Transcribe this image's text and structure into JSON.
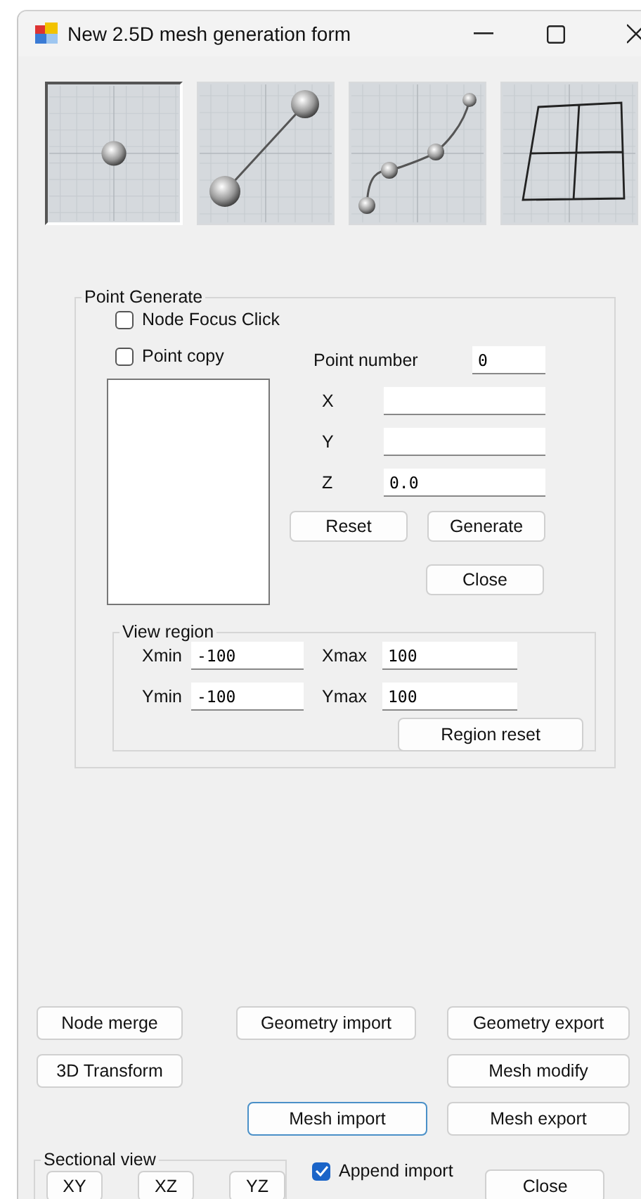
{
  "window": {
    "title": "New 2.5D mesh generation form"
  },
  "modes": [
    {
      "kind": "point",
      "selected": true
    },
    {
      "kind": "line",
      "selected": false
    },
    {
      "kind": "curve",
      "selected": false
    },
    {
      "kind": "quad",
      "selected": false
    }
  ],
  "point_generate": {
    "title": "Point Generate",
    "node_focus_click": {
      "label": "Node Focus Click",
      "checked": false
    },
    "point_copy": {
      "label": "Point copy",
      "checked": false
    },
    "point_number": {
      "label": "Point number",
      "value": "0"
    },
    "coords": [
      {
        "label": "X"
      },
      {
        "label": "Y"
      },
      {
        "label": "Z",
        "value": "0.0"
      }
    ],
    "reset_button": "Reset",
    "generate_button": "Generate",
    "close_button": "Close",
    "view_region": {
      "title": "View region",
      "fields": [
        {
          "label": "Xmin",
          "value": "-100"
        },
        {
          "label": "Xmax",
          "value": "100"
        },
        {
          "label": "Ymin",
          "value": "-100"
        },
        {
          "label": "Ymax",
          "value": "100"
        }
      ],
      "reset_button": "Region reset"
    }
  },
  "actions": {
    "node_merge": "Node merge",
    "geometry_import": "Geometry import",
    "geometry_export": "Geometry export",
    "transform_3d": "3D Transform",
    "mesh_modify": "Mesh modify",
    "mesh_import": "Mesh import",
    "mesh_export": "Mesh export"
  },
  "sectional_view": {
    "title": "Sectional view",
    "buttons": [
      "XY",
      "XZ",
      "YZ"
    ]
  },
  "append_import": {
    "label": "Append import",
    "checked": true
  },
  "close_button": "Close"
}
